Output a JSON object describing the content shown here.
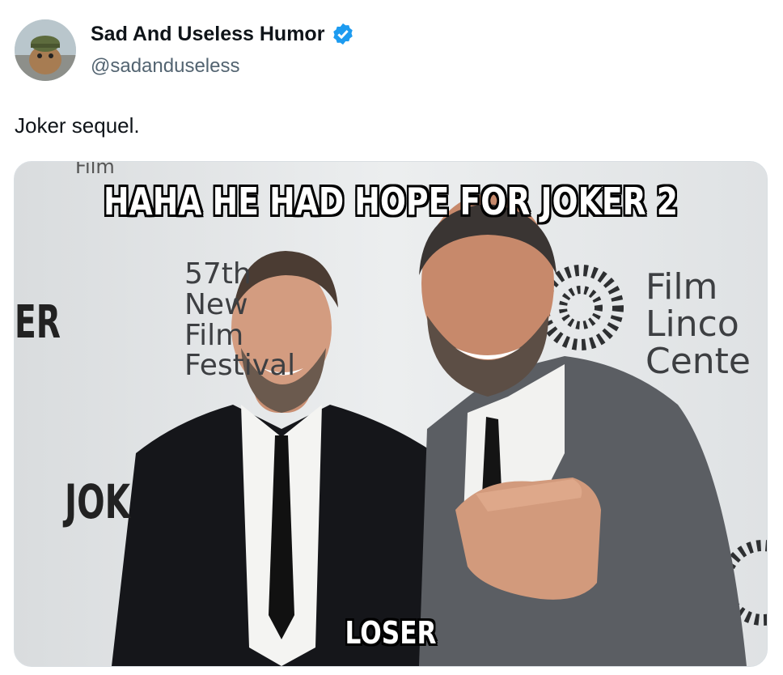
{
  "tweet": {
    "display_name": "Sad And Useless Humor",
    "handle": "@sadanduseless",
    "text": "Joker sequel."
  },
  "meme": {
    "top_caption": "HAHA HE HAD HOPE FOR JOKER 2",
    "bottom_caption": "LOSER",
    "backdrop_festival_lines": [
      "57th",
      "New",
      "Film",
      "Festival"
    ],
    "backdrop_lincoln_lines": [
      "Film",
      "Linco",
      "Cente"
    ],
    "backdrop_left": "ER",
    "backdrop_jok": "JOK",
    "backdrop_film_top": "Film"
  },
  "colors": {
    "verified": "#1d9bf0",
    "handle": "#536471",
    "text": "#0f1419"
  },
  "icons": [
    "verified-badge-icon"
  ]
}
